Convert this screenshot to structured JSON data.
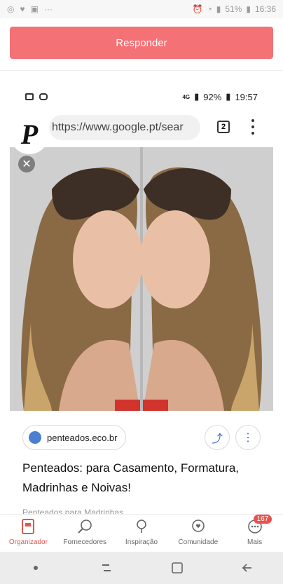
{
  "status_outer": {
    "battery": "51%",
    "time": "16:36",
    "dots": "···"
  },
  "reply_button": {
    "label": "Responder"
  },
  "screenshot": {
    "status": {
      "network": "4G",
      "battery": "92%",
      "time": "19:57"
    },
    "browser": {
      "url": "https://www.google.pt/sear",
      "tab_count": "2",
      "logo_letter": "P"
    },
    "result": {
      "source": "penteados.eco.br",
      "title": "Penteados: para Casamento, Formatura, Madrinhas e Noivas!",
      "subtitle": "Penteados para Madrinhas"
    }
  },
  "bottom_nav": {
    "items": [
      {
        "label": "Organizador",
        "icon": "book-icon",
        "active": true
      },
      {
        "label": "Fornecedores",
        "icon": "search-icon"
      },
      {
        "label": "Inspiração",
        "icon": "bulb-icon"
      },
      {
        "label": "Comunidade",
        "icon": "chat-heart-icon"
      },
      {
        "label": "Mais",
        "icon": "more-icon",
        "badge": "167"
      }
    ]
  },
  "colors": {
    "accent": "#f47176",
    "active": "#e8534f"
  }
}
